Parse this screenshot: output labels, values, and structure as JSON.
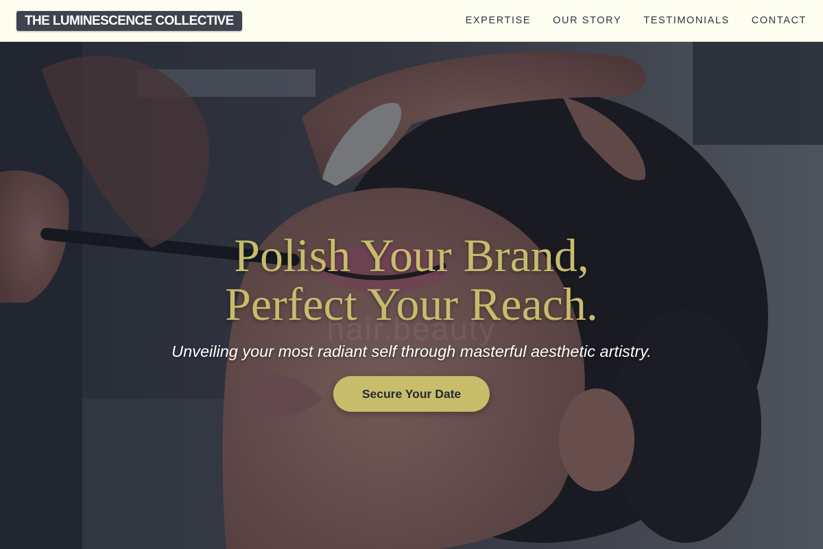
{
  "header": {
    "brand": "THE LUMINESCENCE COLLECTIVE",
    "nav": [
      {
        "label": "EXPERTISE"
      },
      {
        "label": "OUR STORY"
      },
      {
        "label": "TESTIMONIALS"
      },
      {
        "label": "CONTACT"
      }
    ]
  },
  "hero": {
    "headline_line1": "Polish Your Brand,",
    "headline_line2": "Perfect Your Reach.",
    "watermark": "hair.beauty",
    "tagline": "Unveiling your most radiant self through masterful aesthetic artistry.",
    "cta_label": "Secure Your Date",
    "background_image": "photo-makeup-artist-applying-makeup-icon"
  },
  "colors": {
    "header_bg": "#fefef0",
    "brand_bg": "#3f4350",
    "accent_gold": "#c7bc6c",
    "overlay": "#161a26"
  }
}
